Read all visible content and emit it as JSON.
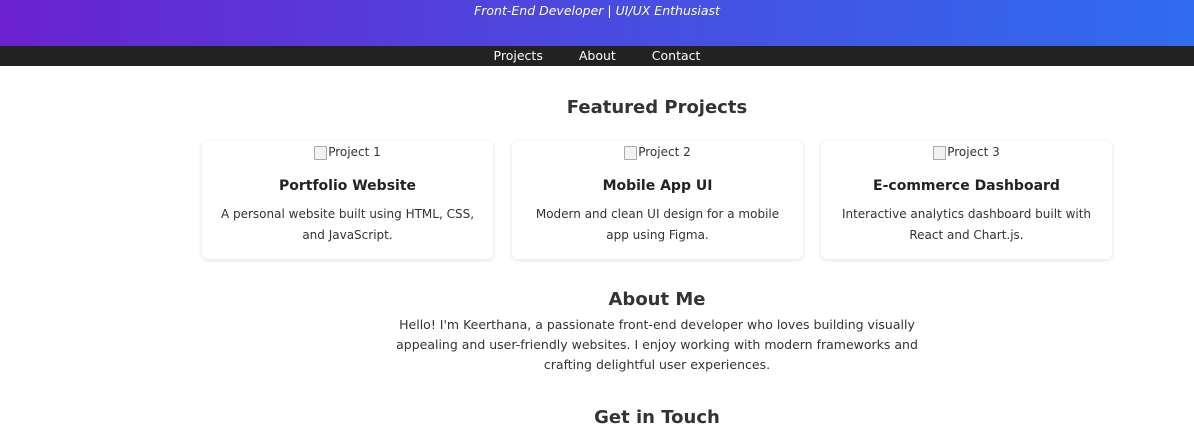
{
  "header": {
    "tagline": "Front-End Developer | UI/UX Enthusiast"
  },
  "nav": {
    "items": [
      "Projects",
      "About",
      "Contact"
    ]
  },
  "projects": {
    "title": "Featured Projects",
    "cards": [
      {
        "image_alt": "Project 1",
        "title": "Portfolio Website",
        "description": "A personal website built using HTML, CSS, and JavaScript."
      },
      {
        "image_alt": "Project 2",
        "title": "Mobile App UI",
        "description": "Modern and clean UI design for a mobile app using Figma."
      },
      {
        "image_alt": "Project 3",
        "title": "E-commerce Dashboard",
        "description": "Interactive analytics dashboard built with React and Chart.js."
      }
    ]
  },
  "about": {
    "title": "About Me",
    "text": "Hello! I'm Keerthana, a passionate front-end developer who loves building visually appealing and user-friendly websites. I enjoy working with modern frameworks and crafting delightful user experiences."
  },
  "contact": {
    "title": "Get in Touch"
  },
  "colors": {
    "gradient_start": "#6a22cf",
    "gradient_end": "#2f6cf0",
    "navbar": "#222222"
  }
}
